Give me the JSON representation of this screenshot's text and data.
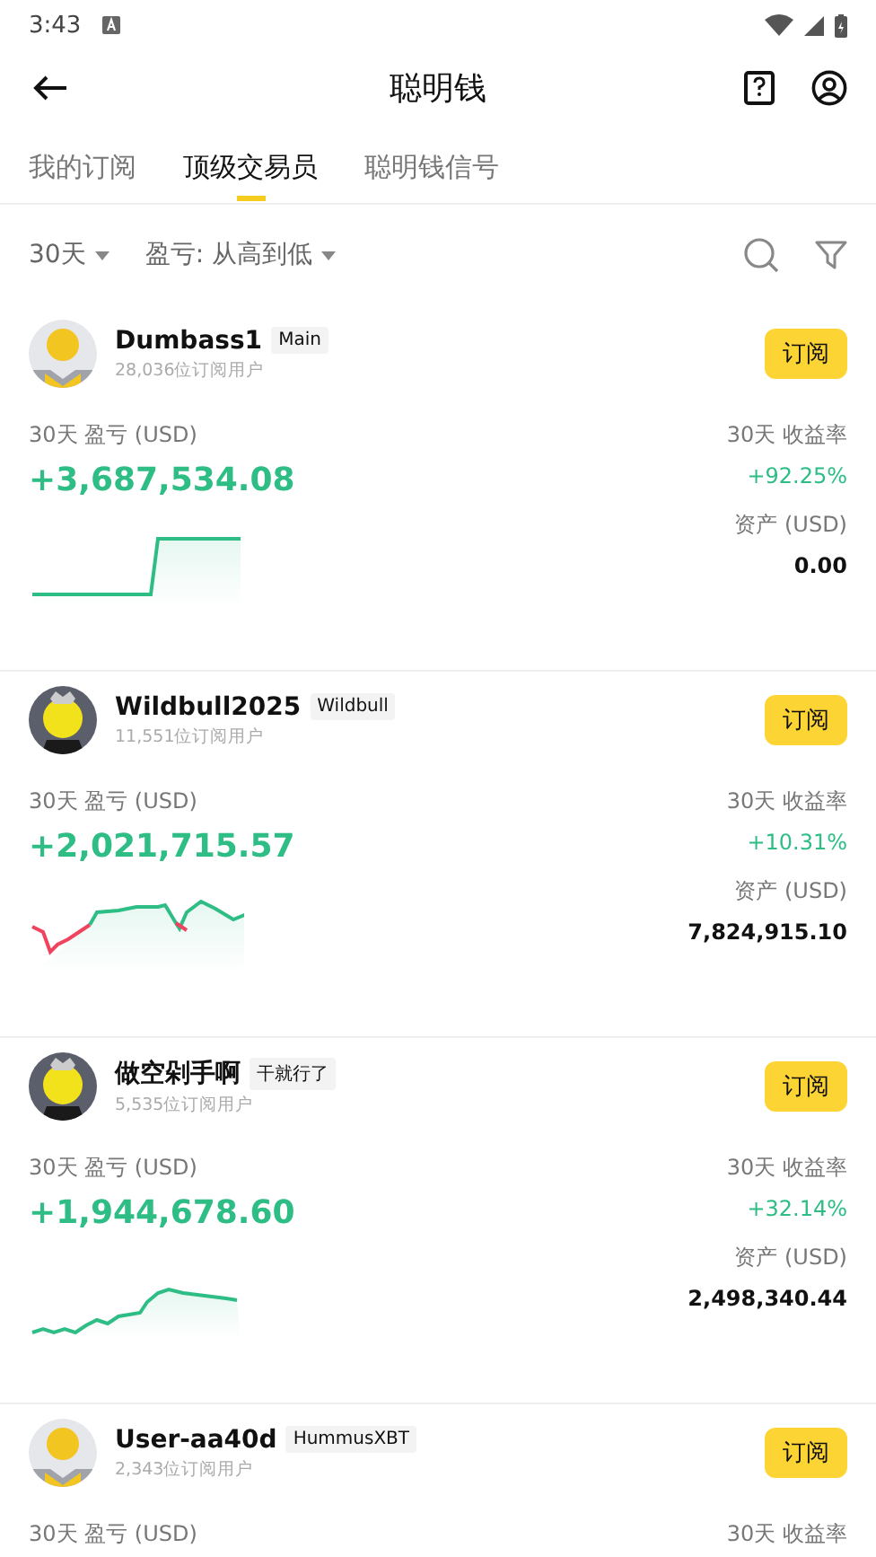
{
  "status_bar": {
    "time": "3:43"
  },
  "header": {
    "title": "聪明钱"
  },
  "tabs": [
    {
      "label": "我的订阅",
      "selected": false
    },
    {
      "label": "顶级交易员",
      "selected": true
    },
    {
      "label": "聪明钱信号",
      "selected": false
    }
  ],
  "filters": {
    "period": "30天",
    "sort": "盈亏: 从高到低"
  },
  "traders": [
    {
      "avatar": {
        "kind": "default"
      },
      "name": "Dumbass1",
      "tag": "Main",
      "subscribers": "28,036位订阅用户",
      "button": "订阅",
      "pnl_label": "30天 盈亏 (USD)",
      "pnl": "+3,687,534.08",
      "rate_label": "30天 收益率",
      "rate": "+92.25%",
      "assets_label": "资产 (USD)",
      "assets": "0.00"
    },
    {
      "avatar": {
        "kind": "cartoon"
      },
      "name": "Wildbull2025",
      "tag": "Wildbull",
      "subscribers": "11,551位订阅用户",
      "button": "订阅",
      "pnl_label": "30天 盈亏 (USD)",
      "pnl": "+2,021,715.57",
      "rate_label": "30天 收益率",
      "rate": "+10.31%",
      "assets_label": "资产 (USD)",
      "assets": "7,824,915.10"
    },
    {
      "avatar": {
        "kind": "cartoon"
      },
      "name": "做空剁手啊",
      "tag": "干就行了",
      "subscribers": "5,535位订阅用户",
      "button": "订阅",
      "pnl_label": "30天 盈亏 (USD)",
      "pnl": "+1,944,678.60",
      "rate_label": "30天 收益率",
      "rate": "+32.14%",
      "assets_label": "资产 (USD)",
      "assets": "2,498,340.44"
    },
    {
      "avatar": {
        "kind": "default"
      },
      "name": "User-aa40d",
      "tag": "HummusXBT",
      "subscribers": "2,343位订阅用户",
      "button": "订阅",
      "pnl_label": "30天 盈亏 (USD)",
      "rate_label": "30天 收益率"
    }
  ]
}
